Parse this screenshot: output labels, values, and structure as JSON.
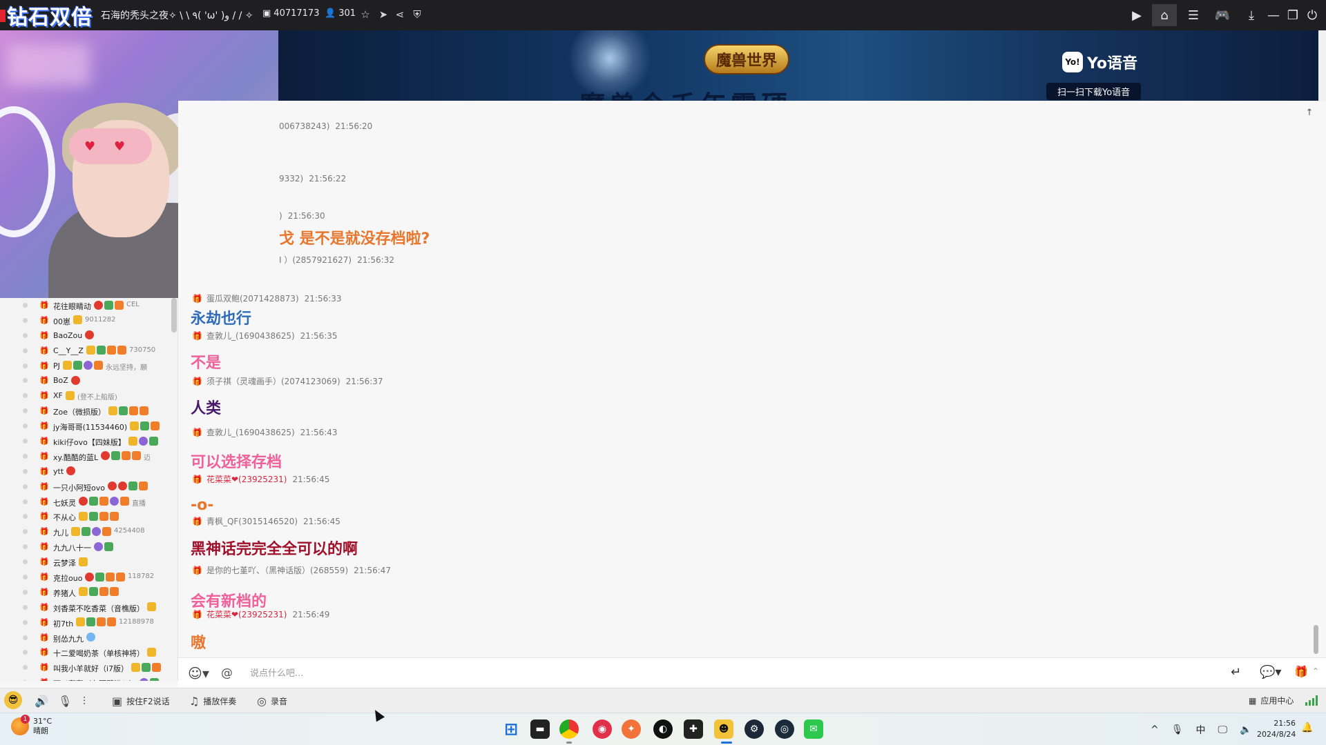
{
  "topbar": {
    "logo_text": "钻石双倍",
    "room_title": "石海的秃头之夜✧ \\ \\ ٩( 'ω' )و / / ✧",
    "room_id": "40717173",
    "viewers": "301",
    "icons": [
      "room-id-icon",
      "user-icon",
      "star-icon",
      "share-arrow-icon",
      "share-icon",
      "shield-icon"
    ],
    "right_icons": [
      "screen-record-icon",
      "home-icon",
      "layout-icon",
      "gamepad-icon",
      "download-icon",
      "minimize-icon",
      "restore-icon",
      "power-icon"
    ]
  },
  "banner": {
    "game_logo": "魔兽世界",
    "big_text": "魔兽今千年霸硬",
    "yo_brand": "Yo语音",
    "yo_icon_text": "Yo!",
    "yo_sub": "扫一扫下载Yo语音"
  },
  "members": [
    {
      "name": "花往眼睛动",
      "extra": "CEL"
    },
    {
      "name": "00崽",
      "extra": "9011282"
    },
    {
      "name": "BaoZou",
      "extra": ""
    },
    {
      "name": "C__Y__Z",
      "extra": "730750"
    },
    {
      "name": "PJ",
      "extra": "永远坚持，願"
    },
    {
      "name": "BoZ",
      "extra": ""
    },
    {
      "name": "XF",
      "extra": "(登不上船版)"
    },
    {
      "name": "Zoe（微损版）",
      "extra": ""
    },
    {
      "name": "jy海哥哥(11534460)",
      "extra": ""
    },
    {
      "name": "kiki仔ovo【四妹版】",
      "extra": ""
    },
    {
      "name": "xy.酷酷的蓝L",
      "extra": "迈"
    },
    {
      "name": "ytt",
      "extra": ""
    },
    {
      "name": "一只小阿短ovo",
      "extra": ""
    },
    {
      "name": "七妖灵",
      "extra": "直播"
    },
    {
      "name": "不从心",
      "extra": ""
    },
    {
      "name": "九儿",
      "extra": "4254408"
    },
    {
      "name": "九九八十一",
      "extra": ""
    },
    {
      "name": "云梦泽",
      "extra": ""
    },
    {
      "name": "克拉ouo",
      "extra": "118782"
    },
    {
      "name": "养猪人",
      "extra": ""
    },
    {
      "name": "刘香菜不吃香菜（音樵版）",
      "extra": ""
    },
    {
      "name": "初7th",
      "extra": "12188978"
    },
    {
      "name": "别怂九九",
      "extra": ""
    },
    {
      "name": "十二爱喝奶茶（单核神将）",
      "extra": ""
    },
    {
      "name": "叫我小羊就好（i7版）",
      "extra": ""
    },
    {
      "name": "可以轰轰（在隔壁哟！）",
      "extra": ""
    }
  ],
  "messages": [
    {
      "user": "006738243)",
      "time": "21:56:20",
      "text": "",
      "color": "#333333",
      "user_red": false
    },
    {
      "user": "9332)",
      "time": "21:56:22",
      "text": "",
      "color": "#333333",
      "user_red": false
    },
    {
      "user": ")",
      "time": "21:56:30",
      "text": "戈 是不是就没存档啦?",
      "color": "#e8762c",
      "user_red": false
    },
    {
      "user": "I ）(2857921627)",
      "time": "21:56:32",
      "text": "",
      "color": "#333333",
      "user_red": false
    },
    {
      "user": "蛋瓜双鲍(2071428873)",
      "time": "21:56:33",
      "text": "永劫也行",
      "color": "#2e6bb8",
      "user_red": false
    },
    {
      "user": "查敦儿_(1690438625)",
      "time": "21:56:35",
      "text": "不是",
      "color": "#f0609a",
      "user_red": false
    },
    {
      "user": "须子祺（灵魂画手）(2074123069)",
      "time": "21:56:37",
      "text": "人类",
      "color": "#4a1a6a",
      "user_red": false
    },
    {
      "user": "查敦儿_(1690438625)",
      "time": "21:56:43",
      "text": "可以选择存档",
      "color": "#f0609a",
      "user_red": false
    },
    {
      "user": "花菜菜❤(23925231)",
      "time": "21:56:45",
      "text": "-o-",
      "color": "#e8762c",
      "user_red": true
    },
    {
      "user": "青枫_QF(3015146520)",
      "time": "21:56:45",
      "text": "黑神话完完全全可以的啊",
      "color": "#a0102a",
      "user_red": false
    },
    {
      "user": "是你的七堇吖、（黑神话版）(268559)",
      "time": "21:56:47",
      "text": "会有新档的",
      "color": "#f0609a",
      "user_red": false
    },
    {
      "user": "花菜菜❤(23925231)",
      "time": "21:56:49",
      "text": "嗷",
      "color": "#e8762c",
      "user_red": true
    }
  ],
  "input": {
    "placeholder": "说点什么吧..."
  },
  "toolbar": {
    "push_to_talk": "按住F2说话",
    "play_music": "播放伴奏",
    "record": "录音",
    "app_center": "应用中心"
  },
  "taskbar": {
    "temp": "31°C",
    "weather": "晴朗",
    "weather_badge": "1",
    "ime": "中",
    "time": "21:56",
    "date": "2024/8/24",
    "apps": [
      "windows-start-icon",
      "file-explorer-icon",
      "chrome-icon",
      "netease-music-icon",
      "browser-app-icon",
      "obs-icon",
      "game-app-icon",
      "yy-app-icon",
      "steam-icon",
      "app-icon",
      "wechat-icon"
    ]
  }
}
